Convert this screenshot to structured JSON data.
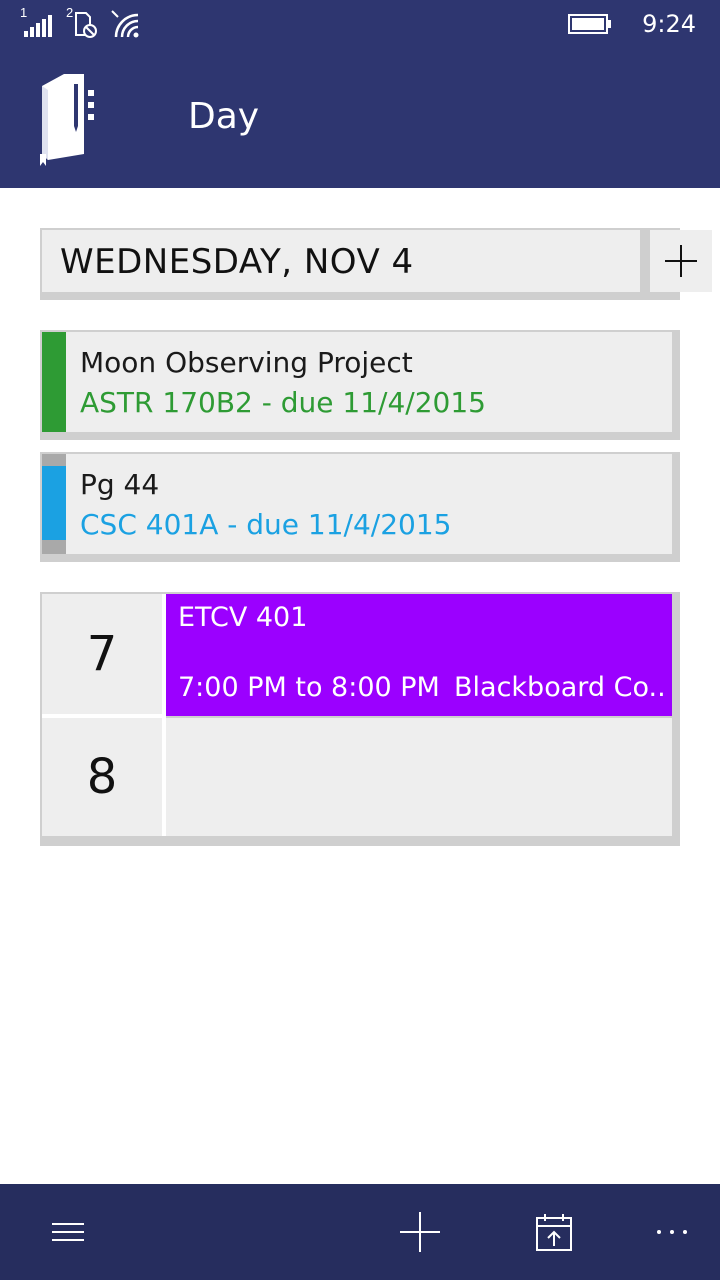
{
  "status_bar": {
    "signal_sim1_label": "1",
    "signal_sim2_label": "2",
    "time": "9:24",
    "icons": [
      "signal-icon",
      "sim-no-service-icon",
      "wifi-icon",
      "battery-icon"
    ]
  },
  "header": {
    "title": "Day",
    "logo_icon": "planner-book-icon",
    "background": "#2e3670"
  },
  "date_bar": {
    "label": "WEDNESDAY, NOV 4",
    "add_icon": "plus-icon"
  },
  "tasks": [
    {
      "title": "Moon Observing Project",
      "subtitle": "ASTR 170B2 - due 11/4/2015",
      "color": "#2e9b34"
    },
    {
      "title": "Pg 44",
      "subtitle": "CSC 401A - due 11/4/2015",
      "color": "#1ba1e2"
    }
  ],
  "schedule": {
    "hours": [
      "7",
      "8"
    ],
    "events": [
      {
        "title": "ETCV 401",
        "time": "7:00 PM to 8:00 PM",
        "location": "Blackboard Co...",
        "color": "#9b00ff"
      }
    ]
  },
  "app_bar": {
    "buttons": [
      "hamburger-icon",
      "plus-icon",
      "calendar-today-icon",
      "more-icon"
    ],
    "background": "#262d5e"
  }
}
